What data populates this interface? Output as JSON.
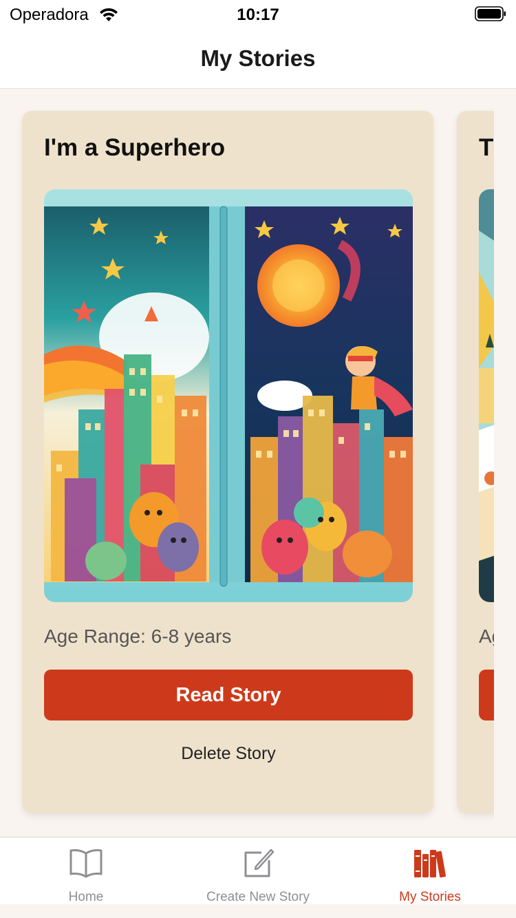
{
  "status_bar": {
    "carrier": "Operadora",
    "time": "10:17",
    "wifi_icon": "wifi-icon",
    "battery_icon": "battery-icon"
  },
  "nav": {
    "title": "My Stories"
  },
  "stories": [
    {
      "title": "I'm a Superhero",
      "age_range": "Age Range: 6-8 years",
      "read_label": "Read Story",
      "delete_label": "Delete Story",
      "cover_image": "superhero-storybook-illustration"
    },
    {
      "title": "T",
      "age_range": "Ag",
      "read_label": "",
      "delete_label": "",
      "cover_image": "storybook-illustration-partial"
    }
  ],
  "tab_bar": {
    "items": [
      {
        "label": "Home",
        "icon": "book-icon",
        "active": false
      },
      {
        "label": "Create New Story",
        "icon": "compose-icon",
        "active": false
      },
      {
        "label": "My Stories",
        "icon": "books-icon",
        "active": true
      }
    ]
  },
  "colors": {
    "accent": "#cd3a1b",
    "card_background": "#efe2cc",
    "page_background": "#faf4f0",
    "inactive_tab": "#8e8e93"
  }
}
